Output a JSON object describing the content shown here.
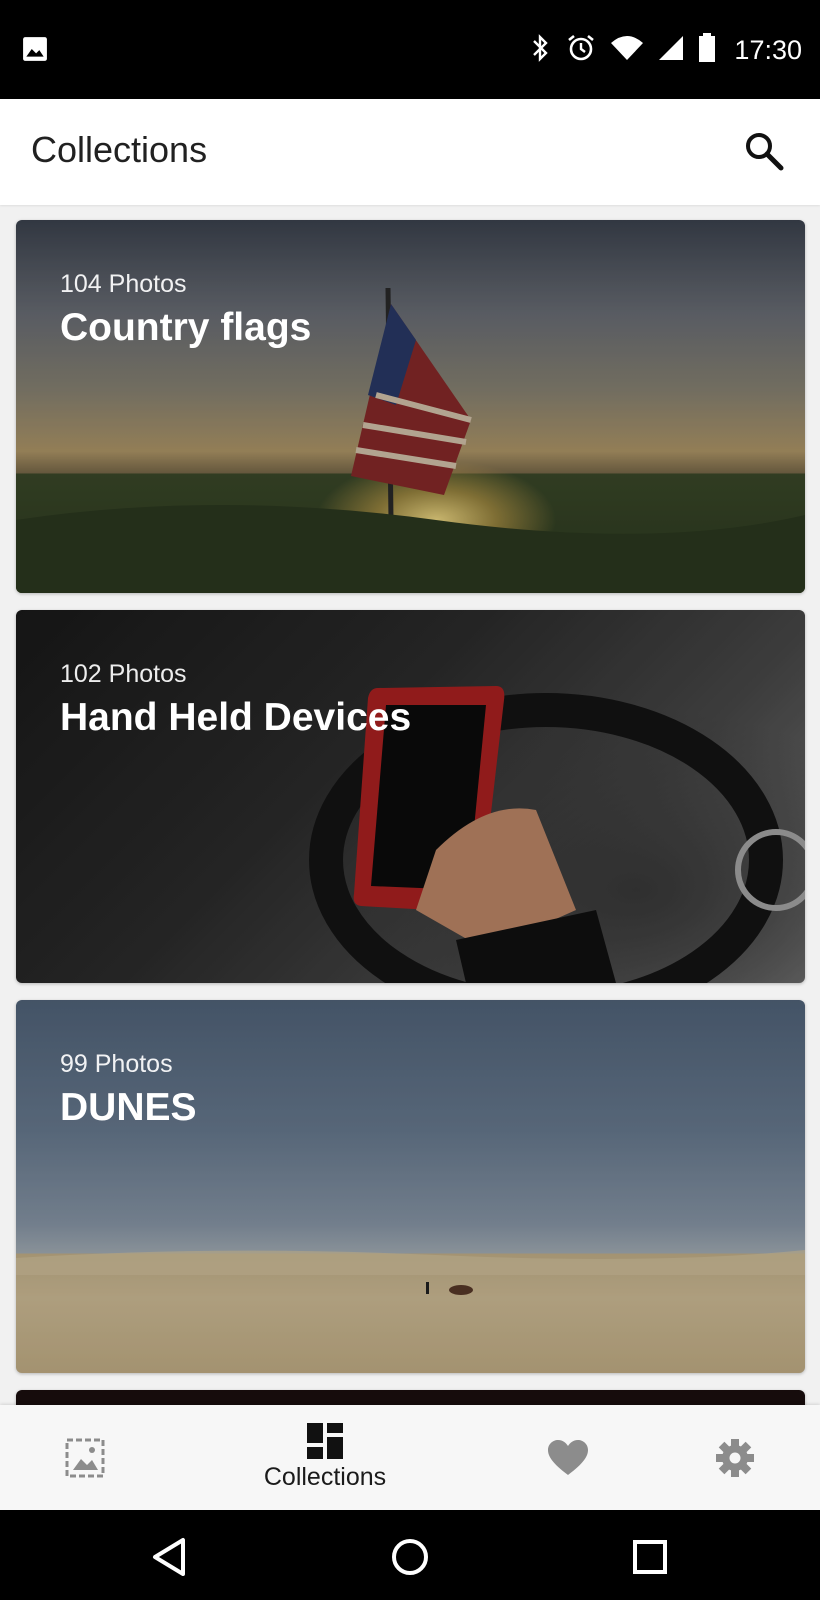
{
  "status_bar": {
    "time": "17:30",
    "icons": [
      "image-icon",
      "bluetooth-icon",
      "alarm-icon",
      "wifi-icon",
      "signal-icon",
      "battery-icon"
    ]
  },
  "app_bar": {
    "title": "Collections",
    "search_icon": "search-icon"
  },
  "collections": [
    {
      "count": "104 Photos",
      "title": "Country flags"
    },
    {
      "count": "102 Photos",
      "title": "Hand Held Devices"
    },
    {
      "count": "99 Photos",
      "title": "DUNES"
    }
  ],
  "bottom_nav": {
    "items": [
      {
        "icon": "photos-icon",
        "label": ""
      },
      {
        "icon": "collections-icon",
        "label": "Collections",
        "active": true
      },
      {
        "icon": "heart-icon",
        "label": ""
      },
      {
        "icon": "gear-icon",
        "label": ""
      }
    ]
  },
  "system_nav": [
    "back-icon",
    "home-icon",
    "recents-icon"
  ],
  "colors": {
    "status_bar": "#000000",
    "app_bar": "#ffffff",
    "nav_active": "#1b1b1b",
    "nav_inactive": "#8c8c8c"
  }
}
